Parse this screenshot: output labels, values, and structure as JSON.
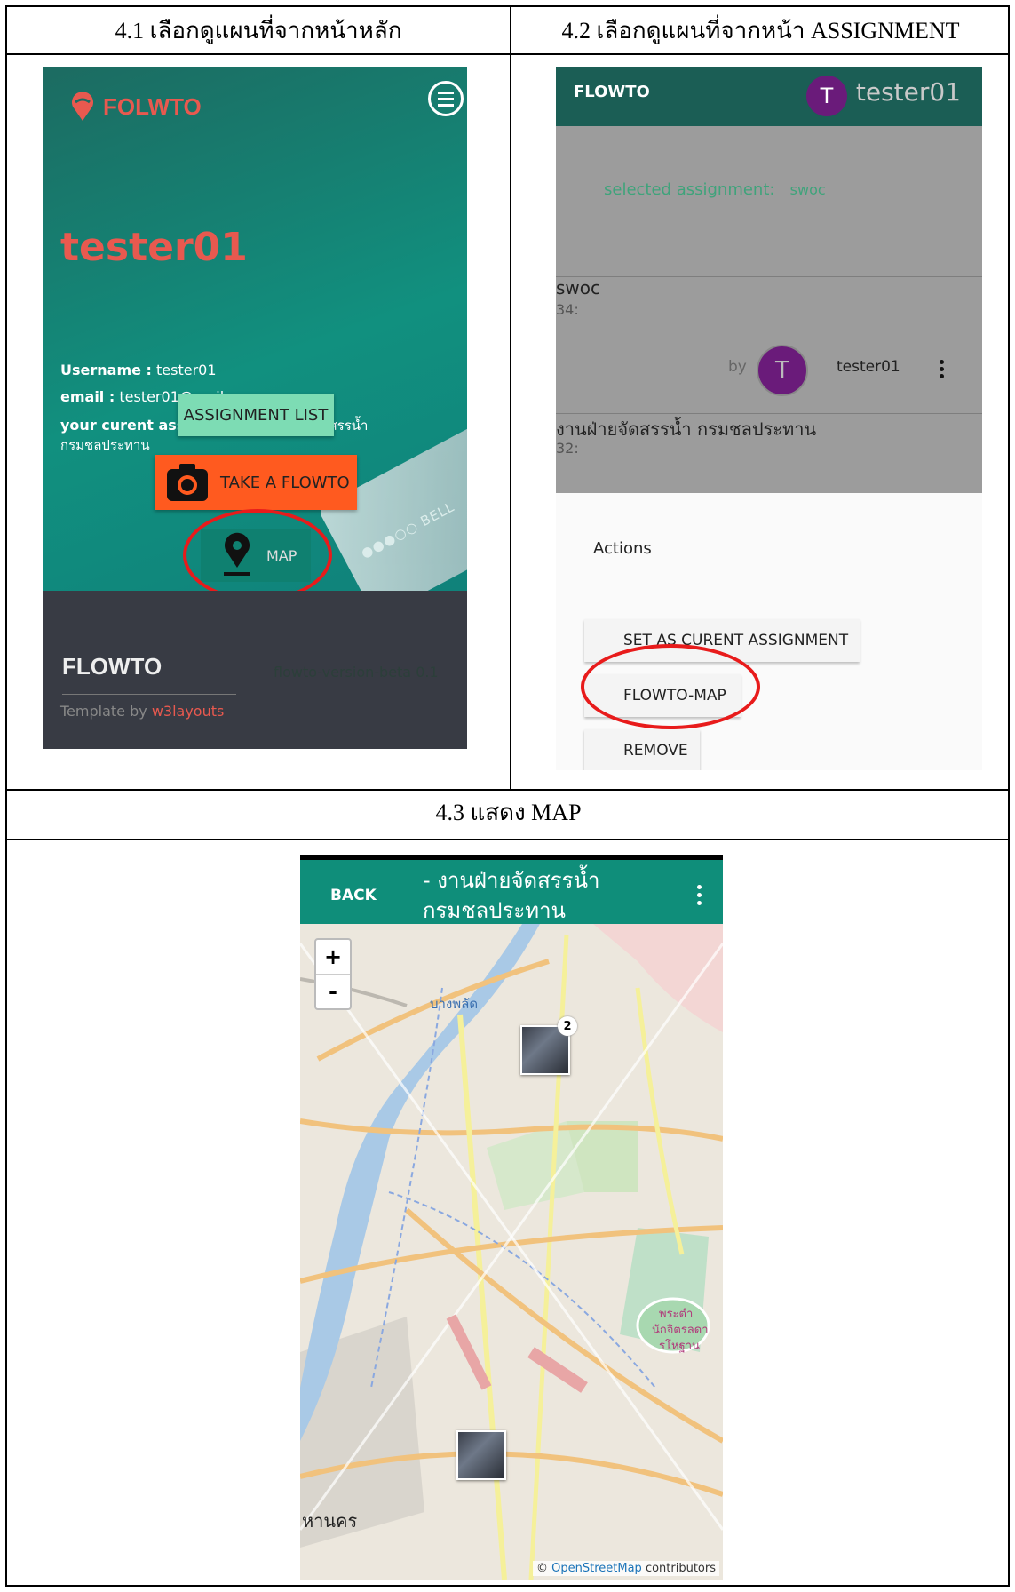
{
  "captions": {
    "c41": "4.1 เลือกดูแผนที่จากหน้าหลัก",
    "c42": "4.2 เลือกดูแผนที่จากหน้า ASSIGNMENT",
    "c43": "4.3 แสดง MAP"
  },
  "panel1": {
    "logo": "FOLWTO",
    "username_big": "tester01",
    "username_label": "Username :",
    "username_value": "tester01",
    "email_label": "email :",
    "email_value": "tester01@mail.com",
    "assignment_label": "your curent assignment :",
    "assignment_value_1": "งานฝ่ายจัดสรรน้ำ",
    "assignment_value_2": "กรมชลประทาน",
    "btn_assignment_list": "ASSIGNMENT LIST",
    "btn_take": "TAKE A FLOWTO",
    "btn_map": "MAP",
    "phone_text": "●●●○○ BELL",
    "footer_title": "FLOWTO",
    "footer_version": "flowto-version-beta 0.1",
    "template_by": "Template by ",
    "template_link": "w3layouts"
  },
  "panel2": {
    "brand": "FLOWTO",
    "avatar_letter": "T",
    "user": "tester01",
    "selected_label": "selected assignment:",
    "selected_value": "swoc",
    "items": [
      {
        "title": "swoc",
        "sub": "34:",
        "by": "by",
        "avatar": "T",
        "user": "tester01"
      },
      {
        "title": "งานฝ่ายจัดสรรน้ำ กรมชลประทาน",
        "sub": "32:"
      }
    ],
    "actions_title": "Actions",
    "btn_set": "SET AS CURENT ASSIGNMENT",
    "btn_map": "FLOWTO-MAP",
    "btn_remove": "REMOVE"
  },
  "panel3": {
    "back": "BACK",
    "title_1": "- งานฝ่ายจัดสรรน้ำ",
    "title_2": "กรมชลประทาน",
    "zoom_in": "+",
    "zoom_out": "-",
    "cluster_count": "2",
    "label_bangphlat": "บางพลัด",
    "label_palace": "พระตำ",
    "label_palace2": "นักจิตรลดา",
    "label_palace3": "รโหฐาน",
    "label_left": "หานคร",
    "attrib_prefix": "© ",
    "attrib_link": "OpenStreetMap",
    "attrib_suffix": " contributors"
  },
  "colors": {
    "highlight_ring": "#e81b1b",
    "teal_bar": "#0f8e7a",
    "avatar_purple": "#6a1b7a",
    "logo_red": "#e8594f"
  }
}
